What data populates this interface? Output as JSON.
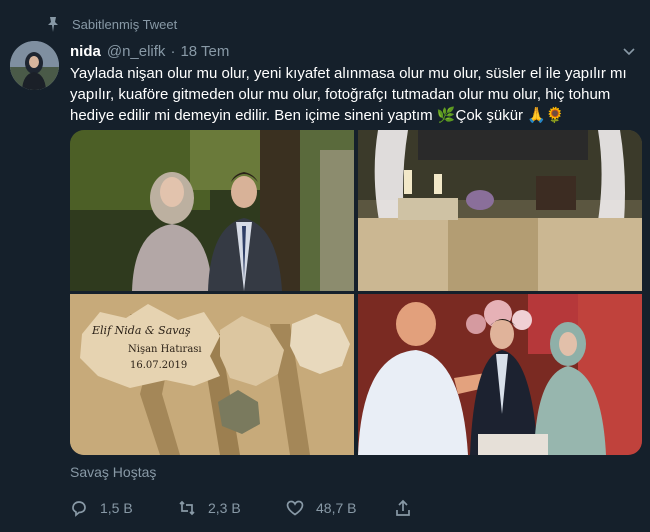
{
  "pinned": {
    "label": "Sabitlenmiş Tweet",
    "icon": "pin-icon"
  },
  "tweet": {
    "name": "nida",
    "handle": "@n_elifk",
    "separator": "·",
    "time": "18 Tem",
    "text": "Yaylada nişan olur mu olur, yeni kıyafet alınmasa olur mu olur, süsler el ile yapılır mı yapılır, kuaföre gitmeden olur mu olur, fotoğrafçı tutmadan olur mu olur, hiç tohum hediye edilir mi demeyin edilir. Ben içime sineni yaptım 🌿Çok şükür 🙏🌻",
    "location": "Savaş Hoştaş"
  },
  "photos": [
    {
      "name": "photo-couple-outdoor",
      "tags": []
    },
    {
      "name": "photo-decorated-table",
      "tags": []
    },
    {
      "name": "photo-engagement-tags",
      "tags": [
        "Elif Nida & Savaş",
        "Nişan Hatırası",
        "16.07.2019"
      ]
    },
    {
      "name": "photo-ring-ceremony",
      "tags": []
    }
  ],
  "actions": {
    "reply_count": "1,5 B",
    "retweet_count": "2,3 B",
    "like_count": "48,7 B"
  },
  "colors": {
    "background": "#15202b",
    "secondary_text": "#8899a6",
    "primary_text": "#ffffff"
  }
}
